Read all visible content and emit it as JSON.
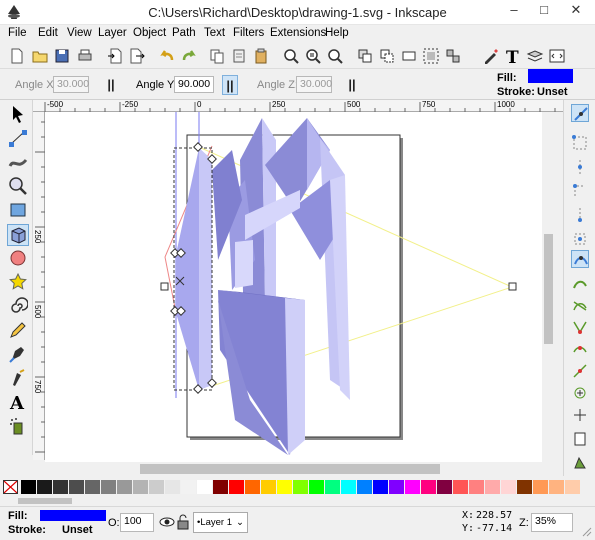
{
  "window": {
    "title": "C:\\Users\\Richard\\Desktop\\drawing-1.svg - Inkscape",
    "minimize": "–",
    "maximize": "□",
    "close": "✕"
  },
  "menu": [
    "File",
    "Edit",
    "View",
    "Layer",
    "Object",
    "Path",
    "Text",
    "Filters",
    "Extensions",
    "Help"
  ],
  "controls": {
    "angle_x_label": "Angle X:",
    "angle_x_value": "30.000",
    "angle_y_label": "Angle Y:",
    "angle_y_value": "90.000",
    "angle_z_label": "Angle Z:",
    "angle_z_value": "30.000",
    "pause_glyph": "||",
    "fill_label": "Fill:",
    "stroke_label": "Stroke:",
    "stroke_value": "Unset",
    "fill_color": "#0000ff"
  },
  "ruler_h": [
    "-500",
    "-250",
    "0",
    "250",
    "500",
    "750",
    "1000"
  ],
  "ruler_v": [
    "250",
    "500",
    "750"
  ],
  "status": {
    "fill_label": "Fill:",
    "stroke_label": "Stroke:",
    "stroke_value": "Unset",
    "fill_color": "#0000ff",
    "opacity_label": "O:",
    "opacity_value": "100",
    "layer_value": "•Layer 1",
    "x_label": "X:",
    "x_value": "228.57",
    "y_label": "Y:",
    "y_value": "-77.14",
    "zoom_label": "Z:",
    "zoom_value": "35%"
  },
  "palette_colors": [
    "#000000",
    "#1a1a1a",
    "#333333",
    "#4d4d4d",
    "#666666",
    "#808080",
    "#999999",
    "#b3b3b3",
    "#cccccc",
    "#e6e6e6",
    "#f2f2f2",
    "#ffffff",
    "#800000",
    "#ff0000",
    "#ff6600",
    "#ffcc00",
    "#ffff00",
    "#80ff00",
    "#00ff00",
    "#00ff80",
    "#00ffff",
    "#0080ff",
    "#0000ff",
    "#8000ff",
    "#ff00ff",
    "#ff0080",
    "#800040",
    "#ff5555",
    "#ff8080",
    "#ffaaaa",
    "#ffd5d5",
    "#803300",
    "#ff9955",
    "#ffb380",
    "#ffccaa"
  ],
  "colors": {
    "accent": "#cde3f6",
    "shape_light": "#ccccff",
    "shape_mid": "#9999e8",
    "shape_dark": "#7a7ad0"
  }
}
